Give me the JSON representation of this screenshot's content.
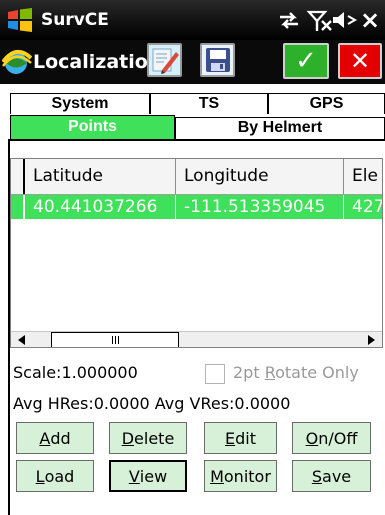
{
  "titlebar": {
    "app_title": "SurvCE",
    "icons": {
      "start": "windows-logo-icon",
      "connectivity": "connectivity-arrows-icon",
      "signal": "no-signal-icon",
      "volume": "speaker-muted-icon",
      "close": "close-icon"
    },
    "close_label": "×"
  },
  "toolbar": {
    "form_title": "Localization",
    "icons": {
      "form": "satellite-globe-icon",
      "edit": "edit-notes-icon",
      "save": "save-disk-icon",
      "ok": "checkmark-icon",
      "cancel": "close-icon"
    },
    "ok_symbol": "✓",
    "cancel_symbol": "✕",
    "colors": {
      "ok": "#2db12a",
      "cancel": "#e40000"
    }
  },
  "tabs": {
    "row1": [
      "System",
      "TS",
      "GPS"
    ],
    "row2": [
      "Points",
      "By Helmert"
    ],
    "active": "Points",
    "active_color": "#3fe05a"
  },
  "grid": {
    "columns": [
      "Latitude",
      "Longitude",
      "Ele"
    ],
    "rows": [
      {
        "latitude": "40.441037266",
        "longitude": "-111.513359045",
        "elevation": "427"
      }
    ],
    "selected_row_color": "#3fe05a"
  },
  "info": {
    "scale": "Scale:1.000000",
    "rotate_label_pre": "2pt ",
    "rotate_label_hotkey": "R",
    "rotate_label_post": "otate Only",
    "rotate_checked": false,
    "residuals": "Avg HRes:0.0000 Avg VRes:0.0000"
  },
  "buttons": {
    "add": {
      "hotkey": "A",
      "rest": "dd"
    },
    "delete": {
      "hotkey": "D",
      "rest": "elete"
    },
    "edit": {
      "hotkey": "E",
      "rest": "dit"
    },
    "onoff": {
      "pre": "",
      "hotkey": "O",
      "rest": "n/Off"
    },
    "load": {
      "hotkey": "L",
      "rest": "oad"
    },
    "view": {
      "hotkey": "V",
      "rest": "iew"
    },
    "monitor": {
      "hotkey": "M",
      "rest": "onitor"
    },
    "save": {
      "hotkey": "S",
      "rest": "ave"
    },
    "button_color": "#d7f0d8"
  }
}
